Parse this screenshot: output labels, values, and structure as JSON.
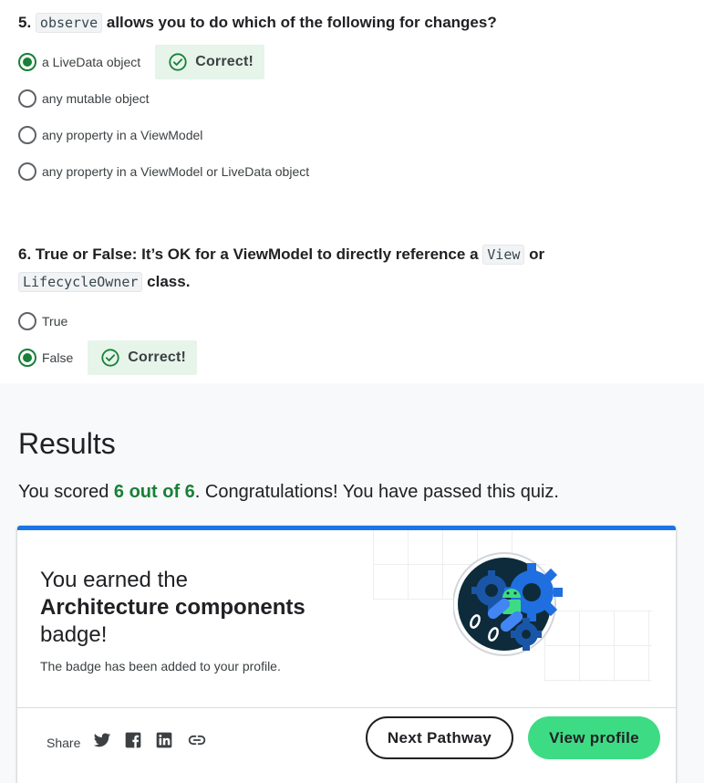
{
  "questions": [
    {
      "number": "5.",
      "code1": "observe",
      "text1": "allows you to do which of the following for changes?",
      "options": [
        {
          "label": "a LiveData object",
          "selected": true,
          "feedback": "Correct!"
        },
        {
          "label": "any mutable object",
          "selected": false
        },
        {
          "label": "any property in a ViewModel",
          "selected": false
        },
        {
          "label": "any property in a ViewModel or LiveData object",
          "selected": false
        }
      ]
    },
    {
      "number": "6.",
      "text1": "True or False: It’s OK for a ViewModel to directly reference a",
      "code1": "View",
      "text2": "or",
      "code2": "LifecycleOwner",
      "text3": "class.",
      "options": [
        {
          "label": "True",
          "selected": false
        },
        {
          "label": "False",
          "selected": true,
          "feedback": "Correct!"
        }
      ]
    }
  ],
  "results": {
    "title": "Results",
    "score_prefix": "You scored",
    "score": "6 out of 6",
    "score_suffix": ". Congratulations! You have passed this quiz."
  },
  "badge_card": {
    "line1": "You earned the",
    "badge_name": "Architecture components",
    "line3": "badge!",
    "added_text": "The badge has been added to your profile.",
    "share_label": "Share",
    "share_icons": [
      "twitter-icon",
      "facebook-icon",
      "linkedin-icon",
      "link-icon"
    ],
    "next_button": "Next Pathway",
    "view_button": "View profile"
  },
  "colors": {
    "accent_blue": "#1a73e8",
    "success_green": "#188038",
    "correct_bg": "#e6f4ea",
    "android_green": "#3ddc84"
  }
}
